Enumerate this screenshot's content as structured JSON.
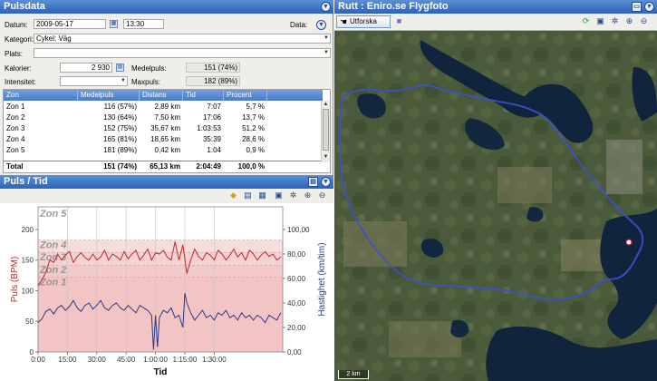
{
  "pulsdata": {
    "title": "Pulsdata",
    "datum_label": "Datum:",
    "datum_value": "2009-05-17",
    "time_value": "13:30",
    "data_label": "Data:",
    "kategori_label": "Kategori:",
    "kategori_value": "Cykel: Väg",
    "plats_label": "Plats:",
    "plats_value": "",
    "kalorier_label": "Kalorier:",
    "kalorier_value": "2 930",
    "medelpuls_label": "Medelpuls:",
    "medelpuls_value": "151 (74%)",
    "intensitet_label": "Intensitet:",
    "intensitet_value": "",
    "maxpuls_label": "Maxpuls:",
    "maxpuls_value": "182 (89%)"
  },
  "zone_table": {
    "headers": [
      "Zon",
      "Medelpuls",
      "Distans",
      "Tid",
      "Procent"
    ],
    "rows": [
      [
        "Zon 1",
        "116 (57%)",
        "2,89 km",
        "7:07",
        "5,7 %"
      ],
      [
        "Zon 2",
        "130 (64%)",
        "7,50 km",
        "17:06",
        "13,7 %"
      ],
      [
        "Zon 3",
        "152 (75%)",
        "35,67 km",
        "1:03:53",
        "51,2 %"
      ],
      [
        "Zon 4",
        "165 (81%)",
        "18,65 km",
        "35:39",
        "28,6 %"
      ],
      [
        "Zon 5",
        "181 (89%)",
        "0,42 km",
        "1:04",
        "0,9 %"
      ]
    ],
    "total": [
      "Total",
      "151 (74%)",
      "65,13 km",
      "2:04:49",
      "100,0 %"
    ]
  },
  "chart_panel": {
    "title": "Puls / Tid"
  },
  "chart_data": {
    "type": "line",
    "xlabel": "Tid",
    "ylabel": "Puls (BPM)",
    "y2label": "Hastighet (km/tim)",
    "x_ticks": [
      "0:00",
      "15:00",
      "30:00",
      "45:00",
      "1:00:00",
      "1:15:00",
      "1:30:00"
    ],
    "x_tick_minutes": [
      0,
      15,
      30,
      45,
      60,
      75,
      90
    ],
    "xlim_minutes": [
      0,
      125
    ],
    "ylim": [
      0,
      237
    ],
    "y_ticks": [
      0,
      50,
      100,
      150,
      200
    ],
    "y2lim": [
      0,
      118.5
    ],
    "y2_ticks": [
      "0,00",
      "20,00",
      "40,00",
      "60,00",
      "80,00",
      "100,00"
    ],
    "y2_tick_values": [
      0,
      20,
      40,
      60,
      80,
      100
    ],
    "zones": [
      {
        "name": "Zon 1",
        "lower": 0,
        "upper": 122
      },
      {
        "name": "Zon 2",
        "lower": 122,
        "upper": 142
      },
      {
        "name": "Zon 3",
        "lower": 142,
        "upper": 163
      },
      {
        "name": "Zon 4",
        "lower": 163,
        "upper": 183
      },
      {
        "name": "Zon 5",
        "lower": 183,
        "upper": 237
      }
    ],
    "series": [
      {
        "name": "Puls",
        "color": "#c0282a",
        "x": [
          0,
          2,
          4,
          6,
          8,
          10,
          12,
          14,
          16,
          18,
          20,
          22,
          24,
          26,
          28,
          30,
          32,
          34,
          36,
          38,
          40,
          42,
          44,
          46,
          48,
          50,
          52,
          54,
          56,
          58,
          60,
          62,
          64,
          66,
          68,
          70,
          72,
          74,
          76,
          78,
          80,
          82,
          84,
          86,
          88,
          90,
          92,
          94,
          96,
          98,
          100,
          102,
          104,
          106,
          108,
          110,
          112,
          114,
          116,
          118,
          120,
          122,
          124
        ],
        "values": [
          108,
          118,
          130,
          150,
          146,
          160,
          150,
          158,
          164,
          146,
          156,
          162,
          154,
          150,
          160,
          150,
          155,
          166,
          150,
          160,
          156,
          150,
          164,
          152,
          160,
          166,
          150,
          158,
          168,
          150,
          162,
          160,
          166,
          155,
          150,
          180,
          150,
          175,
          128,
          150,
          168,
          156,
          150,
          162,
          158,
          150,
          166,
          160,
          150,
          158,
          168,
          155,
          162,
          150,
          166,
          160,
          150,
          158,
          164,
          156,
          160,
          150,
          155
        ]
      },
      {
        "name": "Hastighet",
        "color": "#2a3a88",
        "x": [
          0,
          2,
          4,
          6,
          8,
          10,
          12,
          14,
          16,
          18,
          20,
          22,
          24,
          26,
          28,
          30,
          32,
          34,
          36,
          38,
          40,
          42,
          44,
          46,
          48,
          50,
          52,
          54,
          56,
          58,
          59,
          60,
          61,
          62,
          64,
          66,
          68,
          70,
          72,
          74,
          75,
          76,
          78,
          80,
          82,
          84,
          86,
          88,
          90,
          92,
          94,
          96,
          98,
          100,
          102,
          104,
          106,
          108,
          110,
          112,
          114,
          116,
          118,
          120,
          122,
          124
        ],
        "values": [
          24,
          27,
          33,
          35,
          31,
          36,
          38,
          34,
          37,
          42,
          36,
          33,
          38,
          40,
          35,
          38,
          42,
          36,
          34,
          38,
          40,
          36,
          34,
          38,
          35,
          32,
          38,
          36,
          34,
          30,
          2,
          30,
          4,
          28,
          34,
          32,
          36,
          28,
          30,
          20,
          48,
          40,
          32,
          26,
          30,
          34,
          28,
          30,
          26,
          32,
          30,
          34,
          28,
          30,
          26,
          32,
          28,
          30,
          26,
          30,
          28,
          24,
          30,
          28,
          26,
          32
        ]
      }
    ]
  },
  "map_panel": {
    "title": "Rutt : Eniro.se Flygfoto",
    "utforska_label": "Utforska",
    "scale_label": "2 km"
  }
}
